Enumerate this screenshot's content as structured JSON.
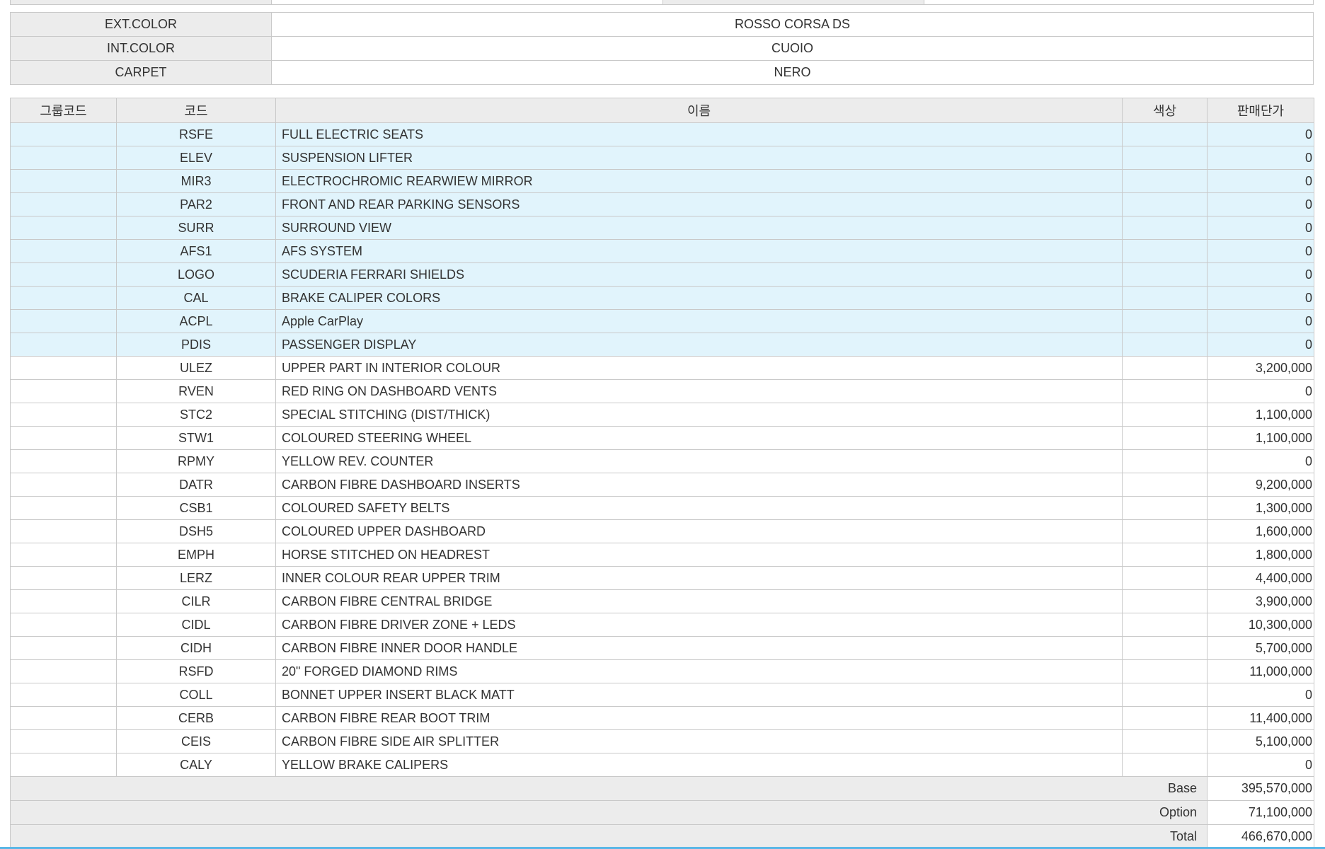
{
  "colors": [
    {
      "label": "EXT.COLOR",
      "value": "ROSSO CORSA DS"
    },
    {
      "label": "INT.COLOR",
      "value": "CUOIO"
    },
    {
      "label": "CARPET",
      "value": "NERO"
    }
  ],
  "headers": {
    "group": "그룹코드",
    "code": "코드",
    "name": "이름",
    "color": "색상",
    "price": "판매단가"
  },
  "options": [
    {
      "code": "RSFE",
      "name": "FULL ELECTRIC SEATS",
      "price": "0",
      "highlight": true
    },
    {
      "code": "ELEV",
      "name": "SUSPENSION LIFTER",
      "price": "0",
      "highlight": true
    },
    {
      "code": "MIR3",
      "name": "ELECTROCHROMIC REARWIEW MIRROR",
      "price": "0",
      "highlight": true
    },
    {
      "code": "PAR2",
      "name": "FRONT AND REAR PARKING SENSORS",
      "price": "0",
      "highlight": true
    },
    {
      "code": "SURR",
      "name": "SURROUND VIEW",
      "price": "0",
      "highlight": true
    },
    {
      "code": "AFS1",
      "name": "AFS SYSTEM",
      "price": "0",
      "highlight": true
    },
    {
      "code": "LOGO",
      "name": "SCUDERIA FERRARI SHIELDS",
      "price": "0",
      "highlight": true
    },
    {
      "code": "CAL",
      "name": "BRAKE CALIPER COLORS",
      "price": "0",
      "highlight": true
    },
    {
      "code": "ACPL",
      "name": "Apple CarPlay",
      "price": "0",
      "highlight": true
    },
    {
      "code": "PDIS",
      "name": "PASSENGER DISPLAY",
      "price": "0",
      "highlight": true
    },
    {
      "code": "ULEZ",
      "name": "UPPER PART IN INTERIOR COLOUR",
      "price": "3,200,000",
      "highlight": false
    },
    {
      "code": "RVEN",
      "name": "RED RING ON DASHBOARD VENTS",
      "price": "0",
      "highlight": false
    },
    {
      "code": "STC2",
      "name": "SPECIAL STITCHING (DIST/THICK)",
      "price": "1,100,000",
      "highlight": false
    },
    {
      "code": "STW1",
      "name": "COLOURED STEERING WHEEL",
      "price": "1,100,000",
      "highlight": false
    },
    {
      "code": "RPMY",
      "name": "YELLOW REV. COUNTER",
      "price": "0",
      "highlight": false
    },
    {
      "code": "DATR",
      "name": "CARBON FIBRE DASHBOARD INSERTS",
      "price": "9,200,000",
      "highlight": false
    },
    {
      "code": "CSB1",
      "name": "COLOURED SAFETY BELTS",
      "price": "1,300,000",
      "highlight": false
    },
    {
      "code": "DSH5",
      "name": "COLOURED UPPER DASHBOARD",
      "price": "1,600,000",
      "highlight": false
    },
    {
      "code": "EMPH",
      "name": "HORSE STITCHED ON HEADREST",
      "price": "1,800,000",
      "highlight": false
    },
    {
      "code": "LERZ",
      "name": "INNER COLOUR REAR UPPER TRIM",
      "price": "4,400,000",
      "highlight": false
    },
    {
      "code": "CILR",
      "name": "CARBON FIBRE CENTRAL BRIDGE",
      "price": "3,900,000",
      "highlight": false
    },
    {
      "code": "CIDL",
      "name": "CARBON FIBRE DRIVER ZONE + LEDS",
      "price": "10,300,000",
      "highlight": false
    },
    {
      "code": "CIDH",
      "name": "CARBON FIBRE INNER DOOR HANDLE",
      "price": "5,700,000",
      "highlight": false
    },
    {
      "code": "RSFD",
      "name": "20\" FORGED DIAMOND RIMS",
      "price": "11,000,000",
      "highlight": false
    },
    {
      "code": "COLL",
      "name": "BONNET UPPER INSERT BLACK MATT",
      "price": "0",
      "highlight": false
    },
    {
      "code": "CERB",
      "name": "CARBON FIBRE REAR BOOT TRIM",
      "price": "11,400,000",
      "highlight": false
    },
    {
      "code": "CEIS",
      "name": "CARBON FIBRE SIDE AIR SPLITTER",
      "price": "5,100,000",
      "highlight": false
    },
    {
      "code": "CALY",
      "name": "YELLOW BRAKE CALIPERS",
      "price": "0",
      "highlight": false
    }
  ],
  "summary": [
    {
      "label": "Base",
      "value": "395,570,000"
    },
    {
      "label": "Option",
      "value": "71,100,000"
    },
    {
      "label": "Total",
      "value": "466,670,000"
    }
  ],
  "accent_color": "#5ab7e6",
  "highlight_color": "#e1f4fc"
}
